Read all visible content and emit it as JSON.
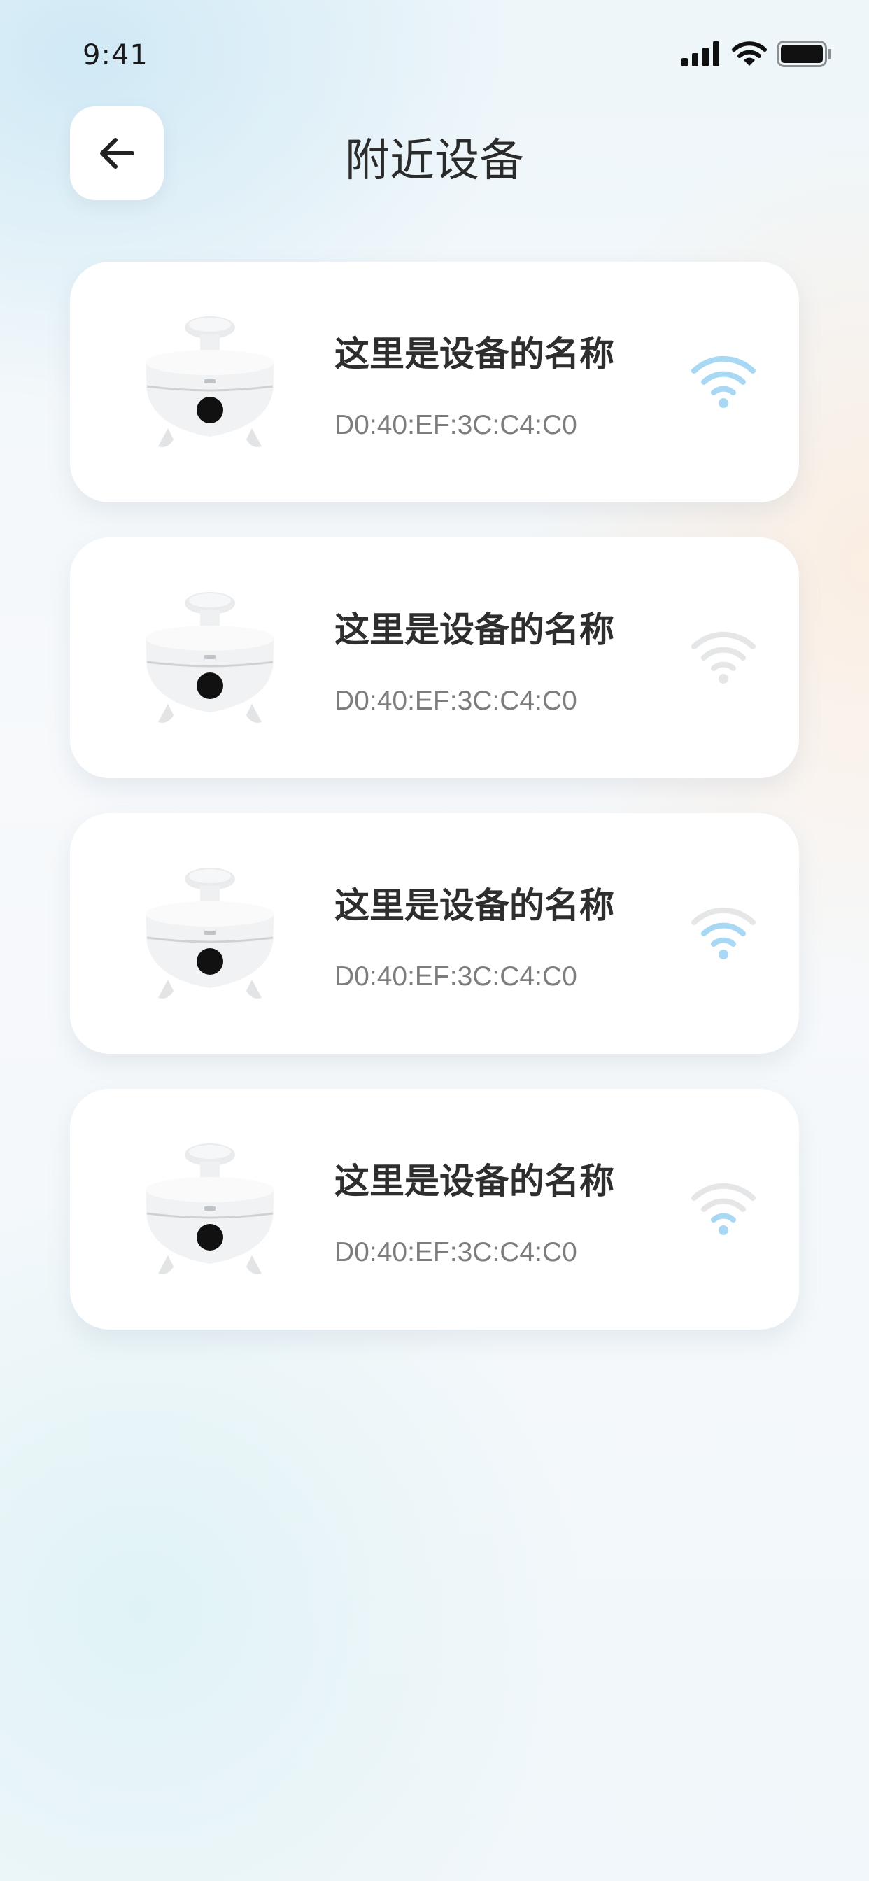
{
  "status_bar": {
    "time": "9:41",
    "icons": [
      "cellular-signal-icon",
      "wifi-icon",
      "battery-icon"
    ]
  },
  "header": {
    "title": "附近设备",
    "back_icon": "arrow-left-icon"
  },
  "devices": [
    {
      "name": "这里是设备的名称",
      "mac": "D0:40:EF:3C:C4:C0",
      "signal": "strong",
      "signal_color": "#a9d8f5",
      "icon": "humidifier-image"
    },
    {
      "name": "这里是设备的名称",
      "mac": "D0:40:EF:3C:C4:C0",
      "signal": "weak",
      "signal_color": "#e4e6e8",
      "icon": "humidifier-image"
    },
    {
      "name": "这里是设备的名称",
      "mac": "D0:40:EF:3C:C4:C0",
      "signal": "medium",
      "signal_color": "#a9d8f5",
      "icon": "humidifier-image"
    },
    {
      "name": "这里是设备的名称",
      "mac": "D0:40:EF:3C:C4:C0",
      "signal": "low",
      "signal_color": "#a9d8f5",
      "icon": "humidifier-image"
    }
  ],
  "colors": {
    "signal_active": "#a9d8f5",
    "signal_inactive": "#e4e6e8",
    "card_background": "#ffffff"
  }
}
